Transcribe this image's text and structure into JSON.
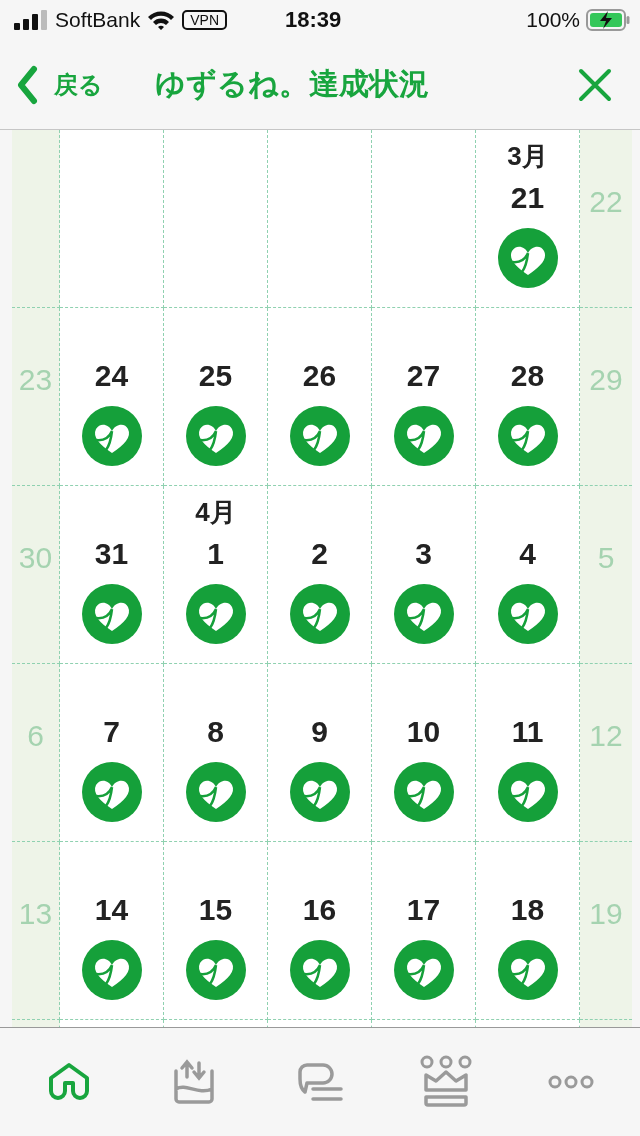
{
  "status_bar": {
    "carrier": "SoftBank",
    "vpn": "VPN",
    "time": "18:39",
    "battery": "100%"
  },
  "nav": {
    "back": "戻る",
    "title": "ゆずるね。達成状況"
  },
  "weeks": [
    {
      "days": [
        {
          "kind": "weekend"
        },
        {
          "kind": "empty"
        },
        {
          "kind": "empty"
        },
        {
          "kind": "empty"
        },
        {
          "kind": "empty"
        },
        {
          "kind": "weekday",
          "month": "3月",
          "label": "21",
          "achieved": true
        },
        {
          "kind": "weekend",
          "label": "22"
        }
      ]
    },
    {
      "days": [
        {
          "kind": "weekend",
          "label": "23"
        },
        {
          "kind": "weekday",
          "label": "24",
          "achieved": true
        },
        {
          "kind": "weekday",
          "label": "25",
          "achieved": true
        },
        {
          "kind": "weekday",
          "label": "26",
          "achieved": true
        },
        {
          "kind": "weekday",
          "label": "27",
          "achieved": true
        },
        {
          "kind": "weekday",
          "label": "28",
          "achieved": true
        },
        {
          "kind": "weekend",
          "label": "29"
        }
      ]
    },
    {
      "days": [
        {
          "kind": "weekend",
          "label": "30"
        },
        {
          "kind": "weekday",
          "label": "31",
          "achieved": true
        },
        {
          "kind": "weekday",
          "month": "4月",
          "label": "1",
          "achieved": true
        },
        {
          "kind": "weekday",
          "label": "2",
          "achieved": true
        },
        {
          "kind": "weekday",
          "label": "3",
          "achieved": true
        },
        {
          "kind": "weekday",
          "label": "4",
          "achieved": true
        },
        {
          "kind": "weekend",
          "label": "5"
        }
      ]
    },
    {
      "days": [
        {
          "kind": "weekend",
          "label": "6"
        },
        {
          "kind": "weekday",
          "label": "7",
          "achieved": true
        },
        {
          "kind": "weekday",
          "label": "8",
          "achieved": true
        },
        {
          "kind": "weekday",
          "label": "9",
          "achieved": true
        },
        {
          "kind": "weekday",
          "label": "10",
          "achieved": true
        },
        {
          "kind": "weekday",
          "label": "11",
          "achieved": true
        },
        {
          "kind": "weekend",
          "label": "12"
        }
      ]
    },
    {
      "days": [
        {
          "kind": "weekend",
          "label": "13"
        },
        {
          "kind": "weekday",
          "label": "14",
          "achieved": true
        },
        {
          "kind": "weekday",
          "label": "15",
          "achieved": true
        },
        {
          "kind": "weekday",
          "label": "16",
          "achieved": true
        },
        {
          "kind": "weekday",
          "label": "17",
          "achieved": true
        },
        {
          "kind": "weekday",
          "label": "18",
          "achieved": true
        },
        {
          "kind": "weekend",
          "label": "19"
        }
      ]
    }
  ],
  "tabs": [
    {
      "selected": true
    },
    {
      "selected": false
    },
    {
      "selected": false
    },
    {
      "selected": false
    },
    {
      "selected": false
    }
  ]
}
